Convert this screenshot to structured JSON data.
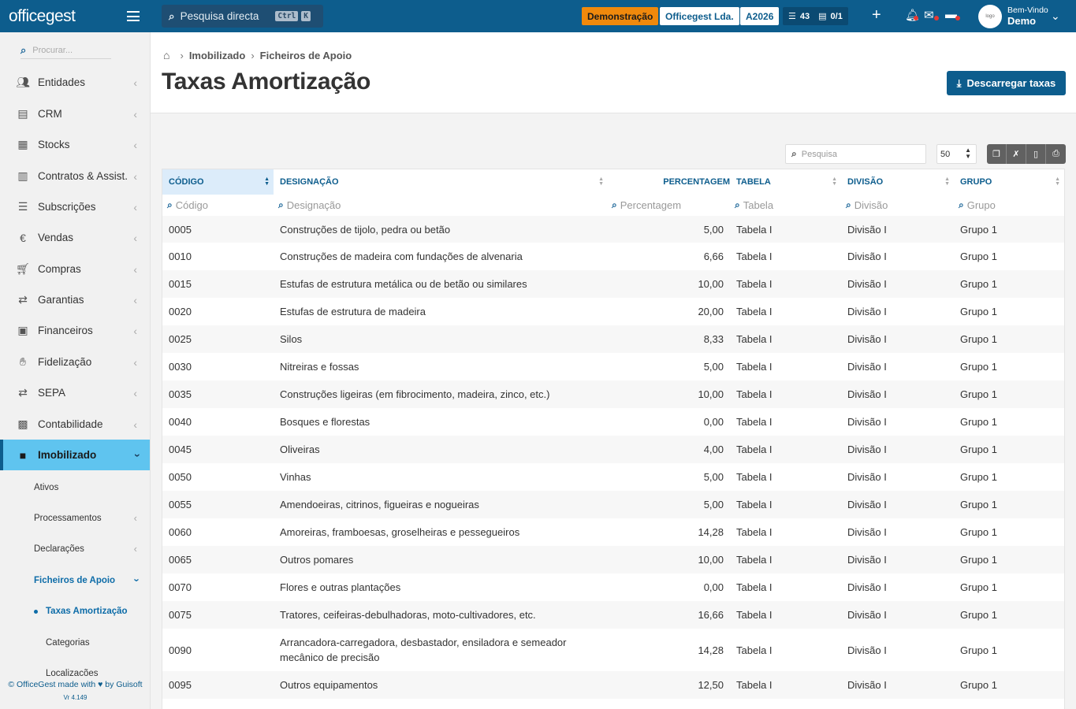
{
  "topbar": {
    "logo_prefix": "office",
    "logo_suffix": "gest",
    "search_placeholder": "Pesquisa directa",
    "shortcut_key1": "Ctrl",
    "shortcut_key2": "K",
    "demo_badge": "Demonstração",
    "company_badge": "Officegest Lda.",
    "year_badge": "A2026",
    "tasks_count": "43",
    "folders_count": "0/1",
    "welcome_label": "Bem-Vindo",
    "user_name": "Demo"
  },
  "sidebar": {
    "search_placeholder": "Procurar...",
    "items": [
      {
        "label": "Entidades",
        "icon": "users-icon"
      },
      {
        "label": "CRM",
        "icon": "book-icon"
      },
      {
        "label": "Stocks",
        "icon": "warehouse-icon"
      },
      {
        "label": "Contratos & Assist.",
        "icon": "file-contract-icon"
      },
      {
        "label": "Subscrições",
        "icon": "list-icon"
      },
      {
        "label": "Vendas",
        "icon": "euro-icon"
      },
      {
        "label": "Compras",
        "icon": "cart-icon"
      },
      {
        "label": "Garantias",
        "icon": "exchange-icon"
      },
      {
        "label": "Financeiros",
        "icon": "money-icon"
      },
      {
        "label": "Fidelização",
        "icon": "hand-icon"
      },
      {
        "label": "SEPA",
        "icon": "exchange-icon"
      },
      {
        "label": "Contabilidade",
        "icon": "calculator-icon"
      },
      {
        "label": "Imobilizado",
        "icon": "boxes-icon"
      }
    ],
    "subitems": [
      "Ativos",
      "Processamentos",
      "Declarações",
      "Ficheiros de Apoio"
    ],
    "subsubitems": [
      "Taxas Amortização",
      "Categorias",
      "Localizações"
    ],
    "footer_text": "© OfficeGest made with ♥ by Guisoft",
    "version": "Vr 4.149"
  },
  "page": {
    "breadcrumb": [
      "Imobilizado",
      "Ficheiros de Apoio"
    ],
    "title": "Taxas Amortização",
    "download_button": "Descarregar taxas"
  },
  "tools": {
    "search_placeholder": "Pesquisa",
    "page_size": "50"
  },
  "table": {
    "headers": {
      "code": "CÓDIGO",
      "desig": "DESIGNAÇÃO",
      "perc": "PERCENTAGEM",
      "tab": "TABELA",
      "div": "DIVISÃO",
      "grp": "GRUPO"
    },
    "filters": {
      "code": "Código",
      "desig": "Designação",
      "perc": "Percentagem",
      "tab": "Tabela",
      "div": "Divisão",
      "grp": "Grupo"
    },
    "rows": [
      {
        "code": "0005",
        "desig": "Construções de tijolo, pedra ou betão",
        "perc": "5,00",
        "tab": "Tabela I",
        "div": "Divisão I",
        "grp": "Grupo 1"
      },
      {
        "code": "0010",
        "desig": "Construções de madeira com fundações de alvenaria",
        "perc": "6,66",
        "tab": "Tabela I",
        "div": "Divisão I",
        "grp": "Grupo 1"
      },
      {
        "code": "0015",
        "desig": "Estufas de estrutura metálica ou de betão ou similares",
        "perc": "10,00",
        "tab": "Tabela I",
        "div": "Divisão I",
        "grp": "Grupo 1"
      },
      {
        "code": "0020",
        "desig": "Estufas de estrutura de madeira",
        "perc": "20,00",
        "tab": "Tabela I",
        "div": "Divisão I",
        "grp": "Grupo 1"
      },
      {
        "code": "0025",
        "desig": "Silos",
        "perc": "8,33",
        "tab": "Tabela I",
        "div": "Divisão I",
        "grp": "Grupo 1"
      },
      {
        "code": "0030",
        "desig": "Nitreiras e fossas",
        "perc": "5,00",
        "tab": "Tabela I",
        "div": "Divisão I",
        "grp": "Grupo 1"
      },
      {
        "code": "0035",
        "desig": "Construções ligeiras (em fibrocimento, madeira, zinco, etc.)",
        "perc": "10,00",
        "tab": "Tabela I",
        "div": "Divisão I",
        "grp": "Grupo 1"
      },
      {
        "code": "0040",
        "desig": "Bosques e florestas",
        "perc": "0,00",
        "tab": "Tabela I",
        "div": "Divisão I",
        "grp": "Grupo 1"
      },
      {
        "code": "0045",
        "desig": "Oliveiras",
        "perc": "4,00",
        "tab": "Tabela I",
        "div": "Divisão I",
        "grp": "Grupo 1"
      },
      {
        "code": "0050",
        "desig": "Vinhas",
        "perc": "5,00",
        "tab": "Tabela I",
        "div": "Divisão I",
        "grp": "Grupo 1"
      },
      {
        "code": "0055",
        "desig": "Amendoeiras, citrinos, figueiras e nogueiras",
        "perc": "5,00",
        "tab": "Tabela I",
        "div": "Divisão I",
        "grp": "Grupo 1"
      },
      {
        "code": "0060",
        "desig": "Amoreiras, framboesas, groselheiras e pessegueiros",
        "perc": "14,28",
        "tab": "Tabela I",
        "div": "Divisão I",
        "grp": "Grupo 1"
      },
      {
        "code": "0065",
        "desig": "Outros pomares",
        "perc": "10,00",
        "tab": "Tabela I",
        "div": "Divisão I",
        "grp": "Grupo 1"
      },
      {
        "code": "0070",
        "desig": "Flores e outras plantações",
        "perc": "0,00",
        "tab": "Tabela I",
        "div": "Divisão I",
        "grp": "Grupo 1"
      },
      {
        "code": "0075",
        "desig": "Tratores, ceifeiras-debulhadoras, moto-cultivadores, etc.",
        "perc": "16,66",
        "tab": "Tabela I",
        "div": "Divisão I",
        "grp": "Grupo 1"
      },
      {
        "code": "0090",
        "desig": "Arrancadora-carregadora, desbastador, ensiladora e semeador mecânico de precisão",
        "perc": "14,28",
        "tab": "Tabela I",
        "div": "Divisão I",
        "grp": "Grupo 1"
      },
      {
        "code": "0095",
        "desig": "Outros equipamentos",
        "perc": "12,50",
        "tab": "Tabela I",
        "div": "Divisão I",
        "grp": "Grupo 1"
      }
    ]
  },
  "colors": {
    "brand": "#0d5d8d",
    "active_menu": "#5fc4ef",
    "demo_badge": "#f0890c"
  }
}
